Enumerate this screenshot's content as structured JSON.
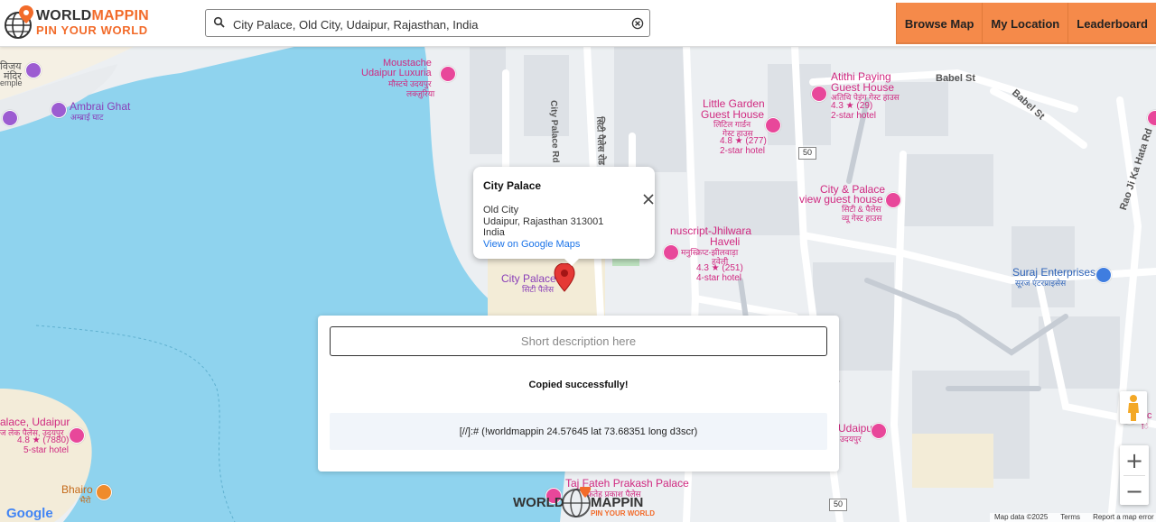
{
  "header": {
    "logo_word_a": "WORLD",
    "logo_word_b": "MAPPIN",
    "logo_tagline": "PIN YOUR WORLD",
    "search_value": "City Palace, Old City, Udaipur, Rajasthan, India",
    "nav": [
      "Browse Map",
      "My Location",
      "Leaderboard"
    ]
  },
  "popup": {
    "title": "City Palace",
    "line1": "Old City",
    "line2": "Udaipur, Rajasthan 313001",
    "line3": "India",
    "link": "View on Google Maps"
  },
  "modal": {
    "placeholder": "Short description here",
    "status": "Copied successfully!",
    "code": "[//]:# (!worldmappin 24.57645 lat 73.68351 long d3scr)"
  },
  "map_labels": {
    "vijay_mandir_1": "विजय",
    "vijay_mandir_2": "मंदिर",
    "temple": "emple",
    "moustache_1": "Moustache",
    "moustache_2": "Udaipur Luxuria",
    "moustache_3": "मौस्टचे उदयपुर",
    "moustache_4": "लक्ज़ुरिया",
    "ambrai_1": "Ambrai Ghat",
    "ambrai_2": "अम्ब्राई घाट",
    "city_palace_rd": "City Palace Rd",
    "city_palace_rd_hi": "सिटी पैलेस रोड",
    "little_garden_1": "Little Garden",
    "little_garden_2": "Guest House",
    "little_garden_3": "लिटिल गार्डन",
    "little_garden_4": "गेस्ट हाउस",
    "little_garden_5": "4.8 ★ (277)",
    "little_garden_6": "2-star hotel",
    "atithi_1": "Atithi Paying",
    "atithi_2": "Guest House",
    "atithi_3": "अतिथि पेइंग गेस्ट हाउस",
    "atithi_4": "4.3 ★ (29)",
    "atithi_5": "2-star hotel",
    "babel_st": "Babel St",
    "babel_st_2": "Babel St",
    "rao_ji": "Rao Ji Ka Hata Rd",
    "view_gh_1": "City & Palace",
    "view_gh_2": "view guest house",
    "view_gh_3": "सिटी & पैलेस",
    "view_gh_4": "व्यू गेस्ट हाउस",
    "jhilwara_1": "nuscript-Jhilwara",
    "jhilwara_2": "Haveli",
    "jhilwara_3": "मनुस्क्रिप्ट-झीलवाड़ा",
    "jhilwara_4": "हवेली",
    "jhilwara_5": "4.3 ★ (251)",
    "jhilwara_6": "4-star hotel",
    "suraj_1": "Suraj Enterprises",
    "suraj_2": "सूरज एंटरप्राइसेस",
    "city_palace_lbl": "City Palace",
    "city_palace_hi": "सिटी पैलेस",
    "lake_palace_1": "alace, Udaipur",
    "lake_palace_2": "ज लेक पैलेस, उदयपुर",
    "lake_palace_3": "4.8 ★ (7880)",
    "lake_palace_4": "5-star hotel",
    "bhairo_1": "Bhairo",
    "bhairo_2": "भैरो",
    "taj_fateh_1": "Taj Fateh Prakash Palace",
    "taj_fateh_2": "फ़तेह प्रकाश पैलेस",
    "udaipur_r1": "Udaipur",
    "udaipur_r2": "उदयपुर",
    "route_50": "50",
    "road_r": "Rd",
    "right_edge": "Hc",
    "right_edge_2": "ि"
  },
  "map_footer": {
    "google": "Google",
    "map_data": "Map data ©2025",
    "terms": "Terms",
    "report": "Report a map error"
  },
  "watermark": {
    "a": "WORLD",
    "b": "MAPPIN",
    "c": "PIN YOUR WORLD"
  },
  "zoom": {
    "in": "+",
    "out": "−"
  },
  "colors": {
    "accent": "#f58a4a",
    "water": "#8fd3ee",
    "link": "#1a73e8",
    "poi_pink": "#e8479a"
  }
}
